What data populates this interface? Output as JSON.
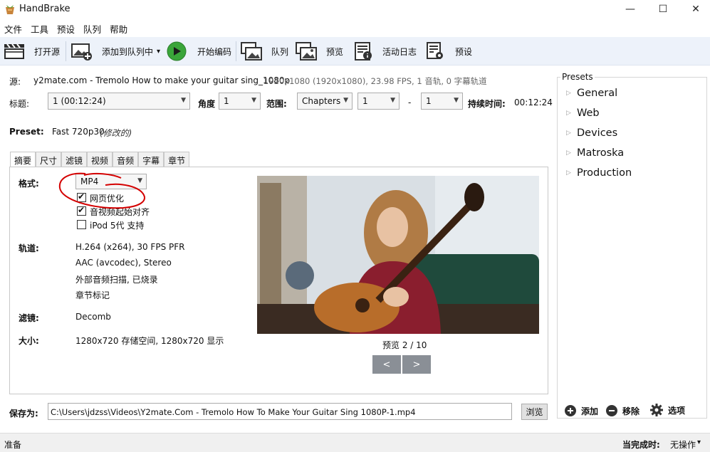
{
  "window": {
    "title": "HandBrake",
    "minimize": "—",
    "maximize": "☐",
    "close": "✕"
  },
  "menu": [
    "文件",
    "工具",
    "预设",
    "队列",
    "帮助"
  ],
  "toolbar": {
    "open_source": "打开源",
    "add_to_queue": "添加到队列中",
    "add_dropdown": "▾",
    "start_encode": "开始编码",
    "queue": "队列",
    "preview": "预览",
    "activity_log": "活动日志",
    "presets": "预设"
  },
  "source": {
    "label": "源:",
    "name": "y2mate.com - Tremolo How to make your guitar sing_1080p",
    "info": "1920x1080 (1920x1080), 23.98 FPS, 1 音轨, 0 字幕轨道"
  },
  "title_row": {
    "title_label": "标题:",
    "title_value": "1  (00:12:24)",
    "angle_label": "角度",
    "angle_value": "1",
    "range_label": "范围:",
    "range_type": "Chapters",
    "range_start": "1",
    "range_dash": "-",
    "range_end": "1",
    "duration_label": "持续时间:",
    "duration_value": "00:12:24"
  },
  "preset_row": {
    "label": "Preset:",
    "value": "Fast 720p30",
    "modified": "(修改的)"
  },
  "tabs": [
    "摘要",
    "尺寸",
    "滤镜",
    "视频",
    "音频",
    "字幕",
    "章节"
  ],
  "summary": {
    "format_label": "格式:",
    "format_value": "MP4",
    "web_optimized": "网页优化",
    "web_optimized_checked": true,
    "align_av": "音视频起始对齐",
    "align_av_checked": true,
    "ipod": "iPod 5代 支持",
    "ipod_checked": false,
    "tracks_label": "轨道:",
    "tracks": [
      "H.264 (x264), 30 FPS PFR",
      "AAC (avcodec), Stereo",
      "外部音频扫描, 已烧录",
      "章节标记"
    ],
    "filters_label": "滤镜:",
    "filters_value": "Decomb",
    "size_label": "大小:",
    "size_value": "1280x720 存储空间, 1280x720 显示",
    "preview_caption": "预览 2 / 10",
    "prev_btn": "<",
    "next_btn": ">"
  },
  "save": {
    "label": "保存为:",
    "path": "C:\\Users\\jdzss\\Videos\\Y2mate.Com - Tremolo How To Make Your Guitar Sing 1080P-1.mp4",
    "browse": "浏览"
  },
  "presets_panel": {
    "title": "Presets",
    "groups": [
      "General",
      "Web",
      "Devices",
      "Matroska",
      "Production"
    ],
    "add": "添加",
    "remove": "移除",
    "options": "选项"
  },
  "status": {
    "left": "准备",
    "when_done_label": "当完成时:",
    "when_done_value": "无操作",
    "when_done_arrow": "▾"
  },
  "colors": {
    "toolbar_bg": "#edf2fa",
    "annotation_red": "#d40000",
    "start_green": "#3aa53a",
    "nav_button": "#8a8f96"
  }
}
